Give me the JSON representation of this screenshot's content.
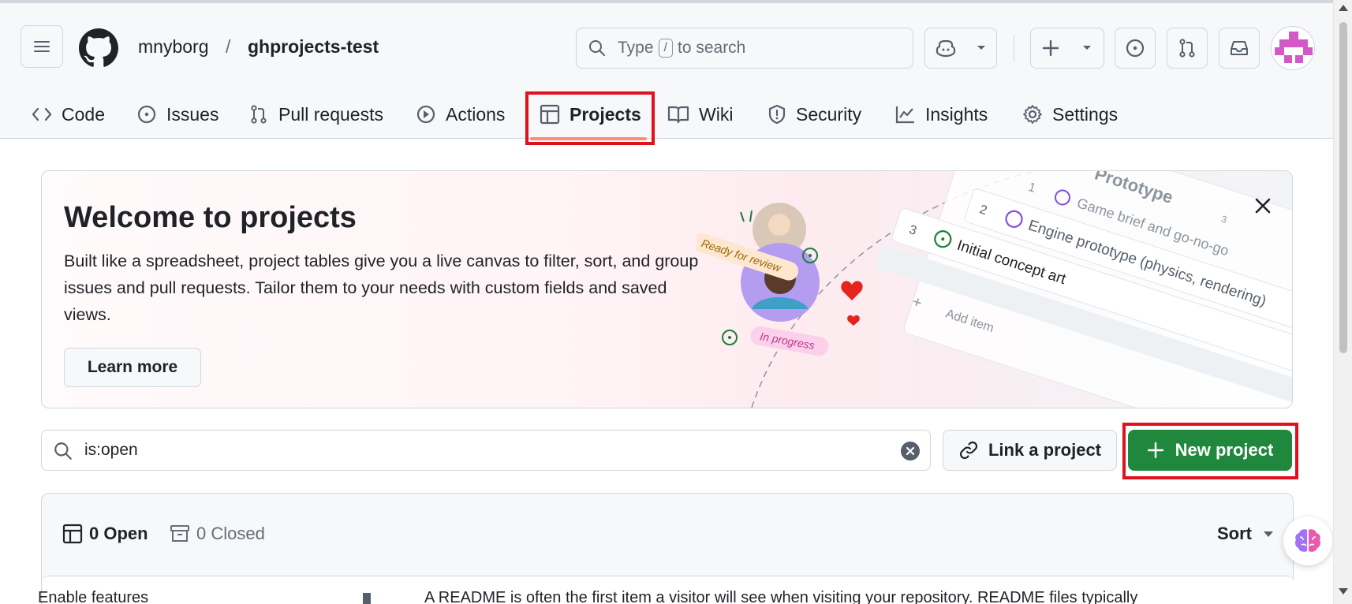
{
  "header": {
    "owner": "mnyborg",
    "separator": "/",
    "repo": "ghprojects-test",
    "search_prefix": "Type",
    "search_key": "/",
    "search_suffix": "to search"
  },
  "tabs": [
    {
      "label": "Code"
    },
    {
      "label": "Issues"
    },
    {
      "label": "Pull requests"
    },
    {
      "label": "Actions"
    },
    {
      "label": "Projects"
    },
    {
      "label": "Wiki"
    },
    {
      "label": "Security"
    },
    {
      "label": "Insights"
    },
    {
      "label": "Settings"
    }
  ],
  "banner": {
    "title": "Welcome to projects",
    "description": "Built like a spreadsheet, project tables give you a live canvas to filter, sort, and group issues and pull requests. Tailor them to your needs with custom fields and saved views.",
    "learn_more": "Learn more",
    "illustration": {
      "group_title": "Prototype",
      "group_count": "3",
      "rows": [
        {
          "num": "1",
          "text": "Game brief and go-no-go"
        },
        {
          "num": "2",
          "text": "Engine prototype (physics, rendering)"
        },
        {
          "num": "3",
          "text": "Initial concept art"
        }
      ],
      "add_item": "Add item",
      "label_review": "Ready for review",
      "label_progress": "In progress"
    }
  },
  "filter": {
    "value": "is:open"
  },
  "actions": {
    "link_project": "Link a project",
    "new_project": "New project"
  },
  "list": {
    "open_count": "0 Open",
    "closed_count": "0 Closed",
    "sort": "Sort"
  },
  "bleed": {
    "left": "Enable features",
    "right": "A README is often the first item a visitor will see when visiting your repository. README files typically"
  },
  "colors": {
    "accent_green": "#1f883d",
    "highlight_red": "#e0101c",
    "tab_underline": "#fd8c73"
  }
}
